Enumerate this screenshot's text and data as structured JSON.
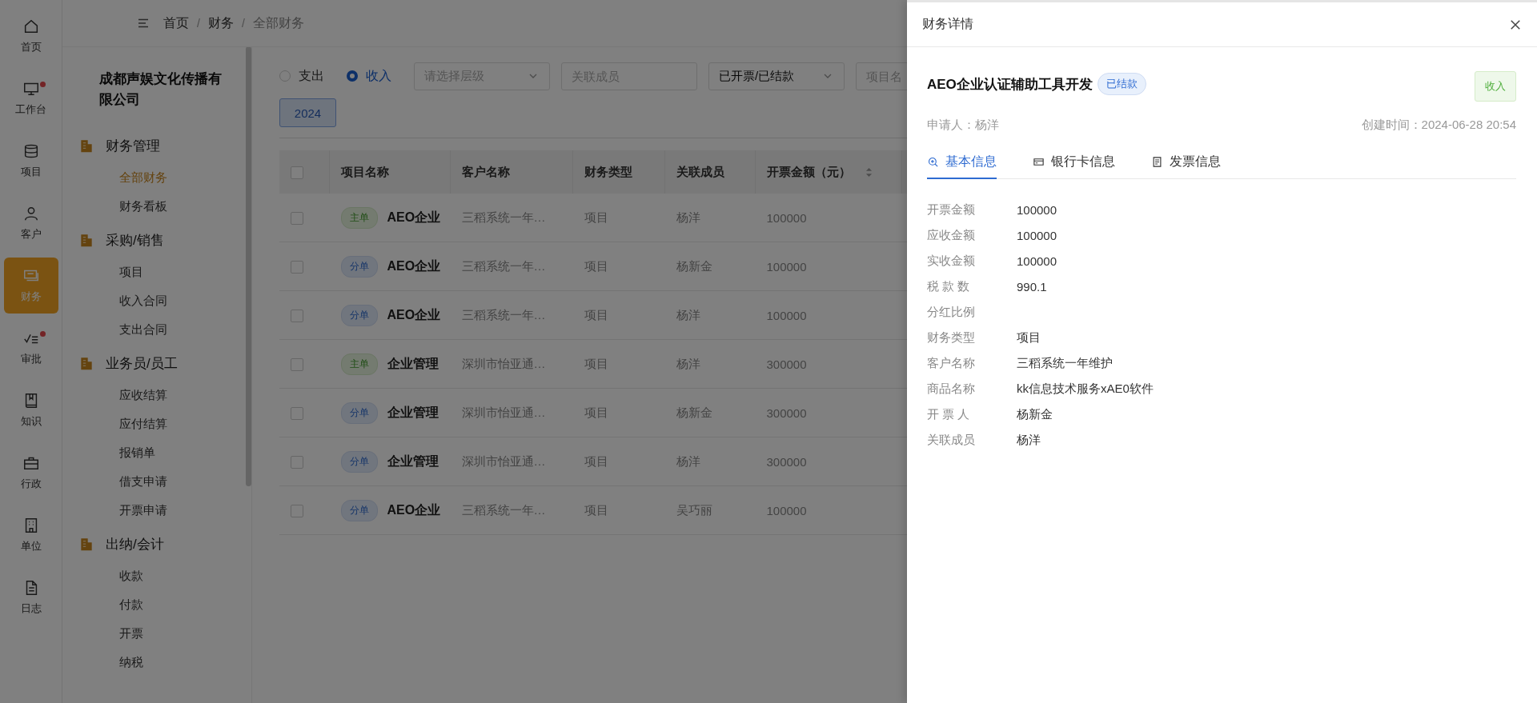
{
  "rail": [
    {
      "label": "首页",
      "selected": false,
      "badge": false
    },
    {
      "label": "工作台",
      "selected": false,
      "badge": true
    },
    {
      "label": "项目",
      "selected": false,
      "badge": false
    },
    {
      "label": "客户",
      "selected": false,
      "badge": false
    },
    {
      "label": "财务",
      "selected": true,
      "badge": false
    },
    {
      "label": "审批",
      "selected": false,
      "badge": true
    },
    {
      "label": "知识",
      "selected": false,
      "badge": false
    },
    {
      "label": "行政",
      "selected": false,
      "badge": false
    },
    {
      "label": "单位",
      "selected": false,
      "badge": false
    },
    {
      "label": "日志",
      "selected": false,
      "badge": false
    }
  ],
  "breadcrumb": [
    {
      "label": "首页",
      "separator": "/"
    },
    {
      "label": "财务",
      "separator": "/"
    },
    {
      "label": "全部财务"
    }
  ],
  "sidebar": {
    "company": "成都声娱文化传播有限公司",
    "groups": [
      {
        "title": "财务管理",
        "items": [
          {
            "label": "全部财务",
            "selected": true
          },
          {
            "label": "财务看板",
            "selected": false
          }
        ]
      },
      {
        "title": "采购/销售",
        "items": [
          {
            "label": "项目",
            "selected": false
          },
          {
            "label": "收入合同",
            "selected": false
          },
          {
            "label": "支出合同",
            "selected": false
          }
        ]
      },
      {
        "title": "业务员/员工",
        "items": [
          {
            "label": "应收结算",
            "selected": false
          },
          {
            "label": "应付结算",
            "selected": false
          },
          {
            "label": "报销单",
            "selected": false
          },
          {
            "label": "借支申请",
            "selected": false
          },
          {
            "label": "开票申请",
            "selected": false
          }
        ]
      },
      {
        "title": "出纳/会计",
        "items": [
          {
            "label": "收款",
            "selected": false
          },
          {
            "label": "付款",
            "selected": false
          },
          {
            "label": "开票",
            "selected": false
          },
          {
            "label": "纳税",
            "selected": false
          }
        ]
      }
    ]
  },
  "filters": {
    "type_options": [
      {
        "label": "支出",
        "selected": false
      },
      {
        "label": "收入",
        "selected": true
      }
    ],
    "level_select": {
      "placeholder": "请选择层级"
    },
    "member_field": {
      "placeholder": "关联成员"
    },
    "status_select": {
      "value": "已开票/已结款"
    },
    "project_field": {
      "placeholder": "项目名"
    },
    "year_button": "2024"
  },
  "table": {
    "select_all_checked": false,
    "columns": [
      "项目名称",
      "客户名称",
      "财务类型",
      "关联成员",
      "开票金额（元）"
    ],
    "rows": [
      {
        "checked": false,
        "kind": "main",
        "tag": "主单",
        "project": "AEO企业",
        "customer": "三稻系统一年…",
        "type": "项目",
        "member": "杨洋",
        "amount": "100000"
      },
      {
        "checked": false,
        "kind": "sub",
        "tag": "分单",
        "project": "AEO企业",
        "customer": "三稻系统一年…",
        "type": "项目",
        "member": "杨新金",
        "amount": "100000"
      },
      {
        "checked": false,
        "kind": "sub",
        "tag": "分单",
        "project": "AEO企业",
        "customer": "三稻系统一年…",
        "type": "项目",
        "member": "杨洋",
        "amount": "100000"
      },
      {
        "checked": false,
        "kind": "main",
        "tag": "主单",
        "project": "企业管理",
        "customer": "深圳市怡亚通…",
        "type": "项目",
        "member": "杨洋",
        "amount": "300000"
      },
      {
        "checked": false,
        "kind": "sub",
        "tag": "分单",
        "project": "企业管理",
        "customer": "深圳市怡亚通…",
        "type": "项目",
        "member": "杨新金",
        "amount": "300000"
      },
      {
        "checked": false,
        "kind": "sub",
        "tag": "分单",
        "project": "企业管理",
        "customer": "深圳市怡亚通…",
        "type": "项目",
        "member": "杨洋",
        "amount": "300000"
      },
      {
        "checked": false,
        "kind": "sub",
        "tag": "分单",
        "project": "AEO企业",
        "customer": "三稻系统一年…",
        "type": "项目",
        "member": "吴巧丽",
        "amount": "100000"
      }
    ]
  },
  "drawer": {
    "title": "财务详情",
    "project_title": "AEO企业认证辅助工具开发",
    "status_badge": "已结款",
    "direction_badge": "收入",
    "applicant": "申请人：杨洋",
    "created": "创建时间：2024-06-28 20:54",
    "tabs": [
      {
        "label": "基本信息",
        "selected": true
      },
      {
        "label": "银行卡信息",
        "selected": false
      },
      {
        "label": "发票信息",
        "selected": false
      }
    ],
    "fields": [
      {
        "label": "开票金额",
        "value": "100000"
      },
      {
        "label": "应收金额",
        "value": "100000"
      },
      {
        "label": "实收金额",
        "value": "100000"
      },
      {
        "label": "税 款 数",
        "value": "990.1"
      },
      {
        "label": "分红比例"
      },
      {
        "label": "财务类型",
        "value": "项目"
      },
      {
        "label": "客户名称",
        "value": "三稻系统一年维护"
      },
      {
        "label": "商品名称",
        "value": "kk信息技术服务xAE0软件"
      },
      {
        "label": "开 票 人",
        "value": "杨新金"
      },
      {
        "label": "关联成员",
        "value": "杨洋"
      }
    ]
  }
}
